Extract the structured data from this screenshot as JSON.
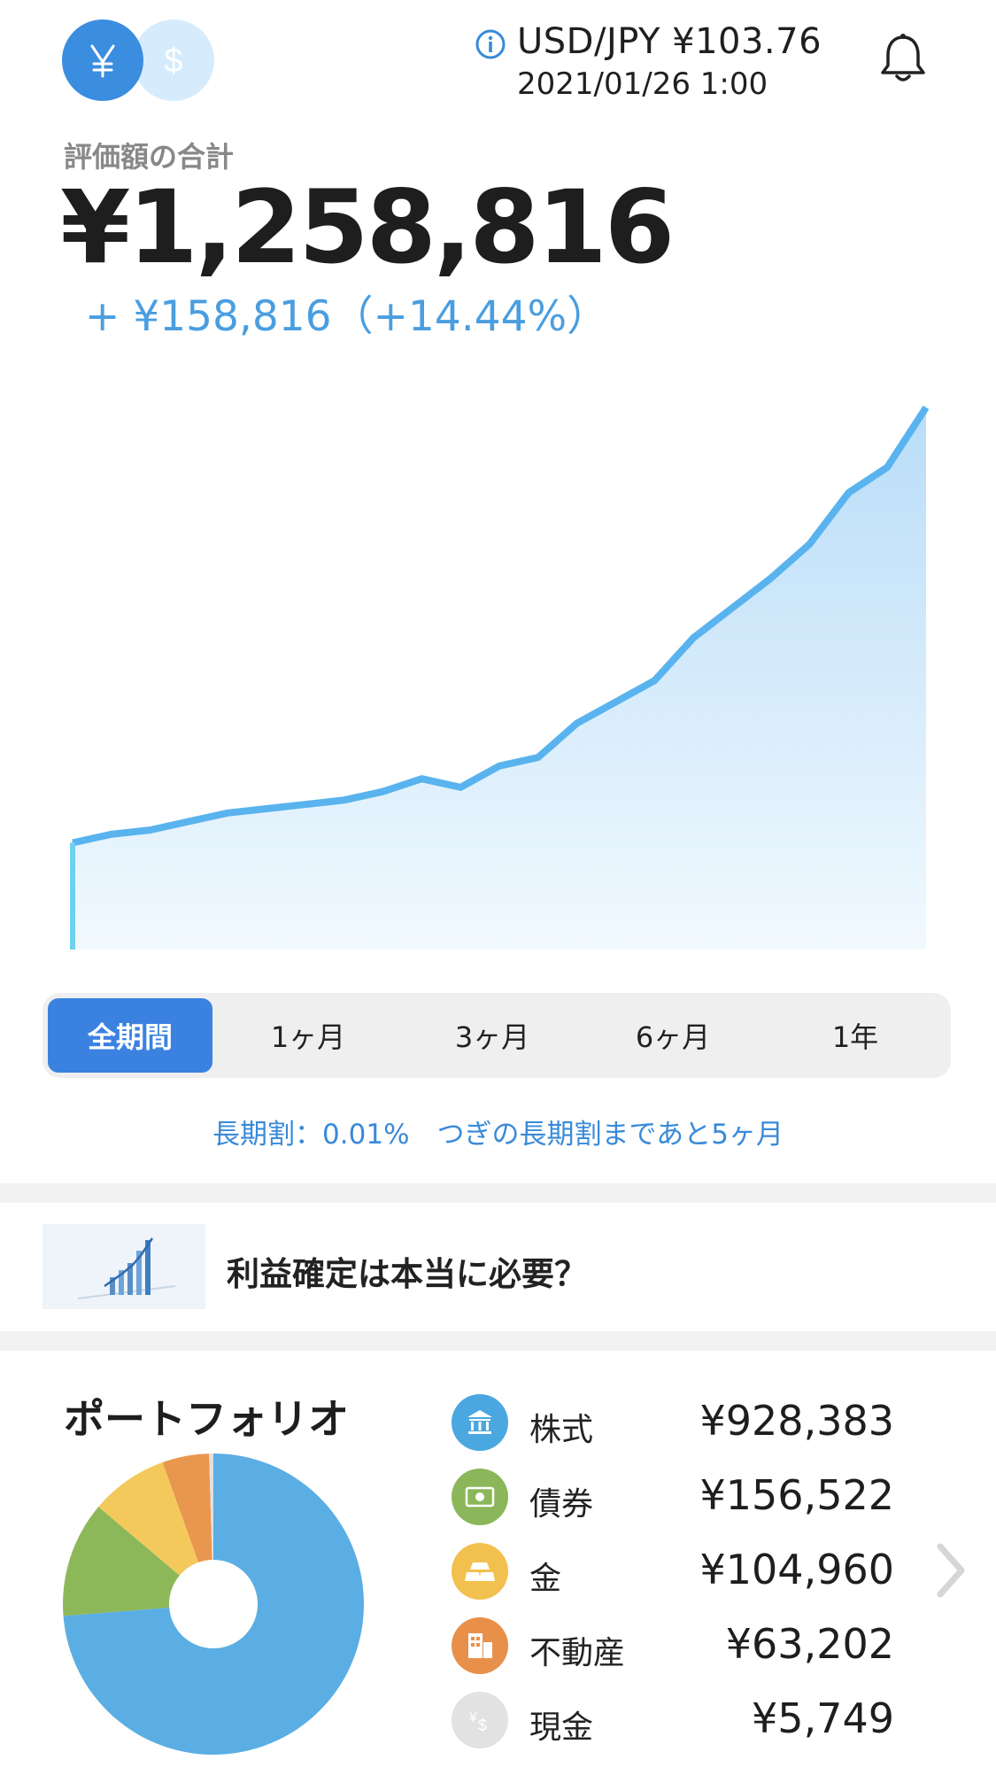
{
  "header": {
    "fx_pair": "USD/JPY  ¥103.76",
    "fx_date": "2021/01/26 1:00",
    "icons": [
      "yen-toggle-icon",
      "dollar-toggle-icon",
      "info-icon",
      "bell-icon"
    ]
  },
  "summary": {
    "label": "評価額の合計",
    "total": "¥1,258,816",
    "change": "+ ¥158,816（+14.44%）"
  },
  "periods": {
    "items": [
      "全期間",
      "1ヶ月",
      "3ヶ月",
      "6ヶ月",
      "1年"
    ],
    "selected": "全期間"
  },
  "discount_text": "長期割：0.01%　つぎの長期割まであと5ヶ月",
  "article": {
    "title": "利益確定は本当に必要？"
  },
  "portfolio": {
    "title": "ポートフォリオ",
    "assets": [
      {
        "name": "株式",
        "value": "¥928,383",
        "color": "#5aaee3",
        "icon": "bank-icon"
      },
      {
        "name": "債券",
        "value": "¥156,522",
        "color": "#8db85a",
        "icon": "bond-icon"
      },
      {
        "name": "金",
        "value": "¥104,960",
        "color": "#f4c95c",
        "icon": "gold-icon"
      },
      {
        "name": "不動産",
        "value": "¥63,202",
        "color": "#e9964f",
        "icon": "building-icon"
      },
      {
        "name": "現金",
        "value": "¥5,749",
        "color": "#e0e0e0",
        "icon": "cash-icon"
      }
    ]
  },
  "chart_data": {
    "type": "area",
    "series": [
      {
        "values": [
          1.0,
          1.02,
          1.03,
          1.05,
          1.07,
          1.08,
          1.09,
          1.1,
          1.12,
          1.15,
          1.13,
          1.18,
          1.2,
          1.28,
          1.33,
          1.38,
          1.48,
          1.55,
          1.62,
          1.7,
          1.82,
          1.88,
          2.02
        ]
      }
    ],
    "colors": {
      "line": "#59b3ee",
      "fill_top": "#b9ddf8",
      "fill_bottom": "#eef7fd"
    }
  }
}
